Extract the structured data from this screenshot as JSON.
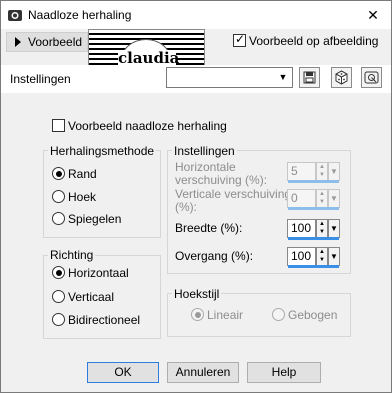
{
  "window": {
    "title": "Naadloze herhaling",
    "close_glyph": "✕"
  },
  "preview": {
    "toggle_label": "Voorbeeld",
    "show_in_image_label": "Voorbeeld op afbeelding",
    "show_in_image_checked": true,
    "logo_text": "claudia"
  },
  "presets": {
    "label": "Instellingen",
    "value": "",
    "icons": [
      "save-icon",
      "dice-icon",
      "reset-icon"
    ]
  },
  "seamless_preview": {
    "label": "Voorbeeld naadloze herhaling",
    "checked": false
  },
  "repeat_method": {
    "title": "Herhalingsmethode",
    "options": [
      {
        "label": "Rand",
        "selected": true
      },
      {
        "label": "Hoek",
        "selected": false
      },
      {
        "label": "Spiegelen",
        "selected": false
      }
    ]
  },
  "direction": {
    "title": "Richting",
    "options": [
      {
        "label": "Horizontaal",
        "selected": true
      },
      {
        "label": "Verticaal",
        "selected": false
      },
      {
        "label": "Bidirectioneel",
        "selected": false
      }
    ]
  },
  "settings": {
    "title": "Instellingen",
    "h_offset": {
      "label": "Horizontale verschuiving (%):",
      "value": "5",
      "enabled": false
    },
    "v_offset": {
      "label": "Verticale verschuiving (%):",
      "value": "0",
      "enabled": false
    },
    "width": {
      "label": "Breedte (%):",
      "value": "100",
      "enabled": true
    },
    "transition": {
      "label": "Overgang (%):",
      "value": "100",
      "enabled": true
    }
  },
  "corner_style": {
    "title": "Hoekstijl",
    "options": [
      {
        "label": "Lineair",
        "selected": true,
        "enabled": false
      },
      {
        "label": "Gebogen",
        "selected": false,
        "enabled": false
      }
    ]
  },
  "buttons": {
    "ok": "OK",
    "cancel": "Annuleren",
    "help": "Help"
  },
  "colors": {
    "accent": "#3b8ee6",
    "default_button_border": "#2d7de0"
  }
}
